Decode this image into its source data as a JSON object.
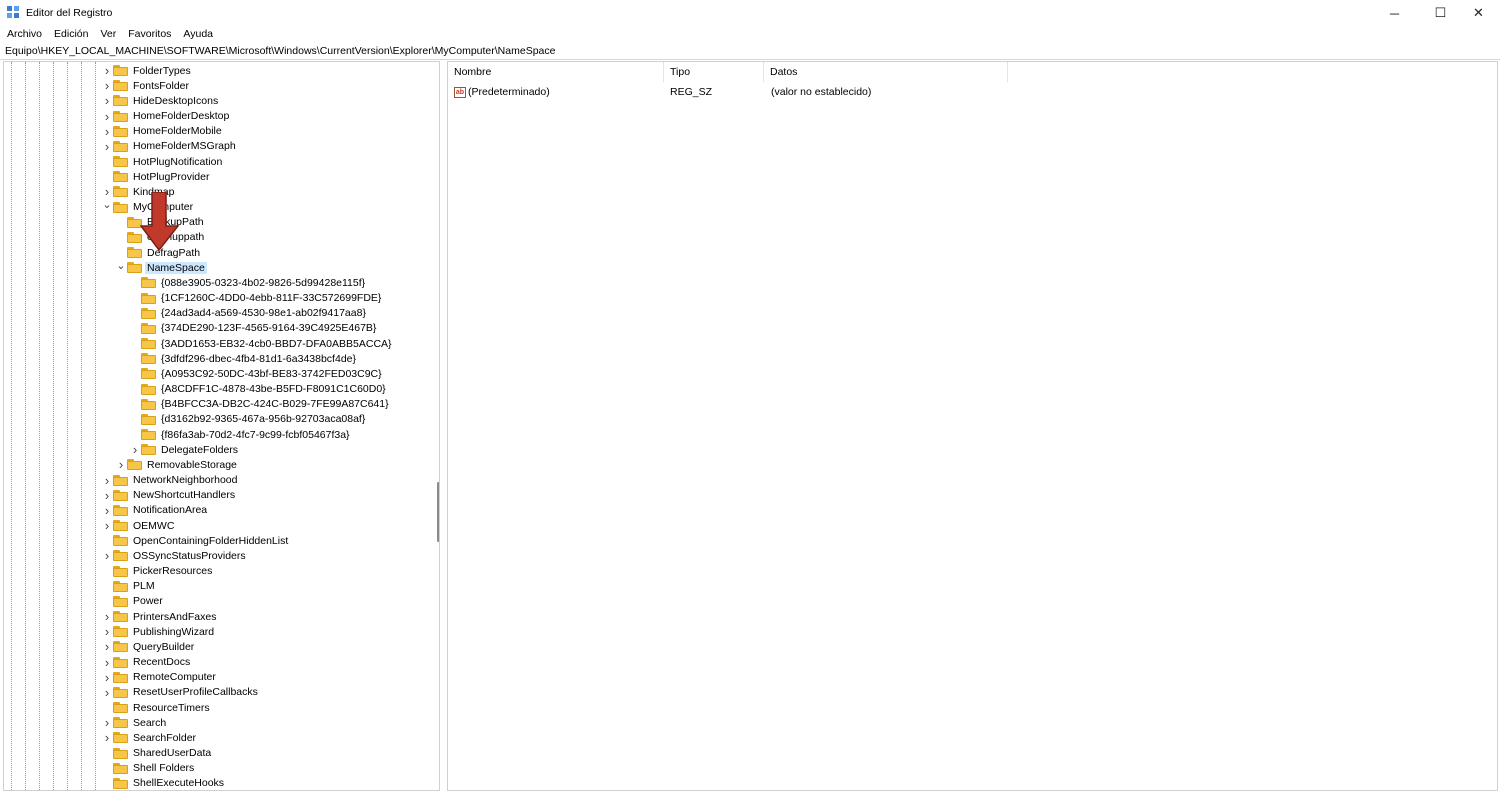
{
  "window": {
    "title": "Editor del Registro",
    "minimize": "─",
    "maximize": "☐",
    "close": "✕"
  },
  "menu": [
    "Archivo",
    "Edición",
    "Ver",
    "Favoritos",
    "Ayuda"
  ],
  "address": "Equipo\\HKEY_LOCAL_MACHINE\\SOFTWARE\\Microsoft\\Windows\\CurrentVersion\\Explorer\\MyComputer\\NameSpace",
  "tree": [
    {
      "label": "FolderTypes",
      "expander": "collapsed",
      "level": 0
    },
    {
      "label": "FontsFolder",
      "expander": "collapsed",
      "level": 0
    },
    {
      "label": "HideDesktopIcons",
      "expander": "collapsed",
      "level": 0
    },
    {
      "label": "HomeFolderDesktop",
      "expander": "collapsed",
      "level": 0
    },
    {
      "label": "HomeFolderMobile",
      "expander": "collapsed",
      "level": 0
    },
    {
      "label": "HomeFolderMSGraph",
      "expander": "collapsed",
      "level": 0
    },
    {
      "label": "HotPlugNotification",
      "expander": "none",
      "level": 0
    },
    {
      "label": "HotPlugProvider",
      "expander": "none",
      "level": 0
    },
    {
      "label": "Kindmap",
      "expander": "collapsed",
      "level": 0
    },
    {
      "label": "MyComputer",
      "expander": "expanded",
      "level": 0
    },
    {
      "label": "BackupPath",
      "expander": "none",
      "level": 1
    },
    {
      "label": "cleanuppath",
      "expander": "none",
      "level": 1
    },
    {
      "label": "DefragPath",
      "expander": "none",
      "level": 1
    },
    {
      "label": "NameSpace",
      "expander": "expanded",
      "level": 1,
      "selected": true
    },
    {
      "label": "{088e3905-0323-4b02-9826-5d99428e115f}",
      "expander": "none",
      "level": 2
    },
    {
      "label": "{1CF1260C-4DD0-4ebb-811F-33C572699FDE}",
      "expander": "none",
      "level": 2
    },
    {
      "label": "{24ad3ad4-a569-4530-98e1-ab02f9417aa8}",
      "expander": "none",
      "level": 2
    },
    {
      "label": "{374DE290-123F-4565-9164-39C4925E467B}",
      "expander": "none",
      "level": 2
    },
    {
      "label": "{3ADD1653-EB32-4cb0-BBD7-DFA0ABB5ACCA}",
      "expander": "none",
      "level": 2
    },
    {
      "label": "{3dfdf296-dbec-4fb4-81d1-6a3438bcf4de}",
      "expander": "none",
      "level": 2
    },
    {
      "label": "{A0953C92-50DC-43bf-BE83-3742FED03C9C}",
      "expander": "none",
      "level": 2
    },
    {
      "label": "{A8CDFF1C-4878-43be-B5FD-F8091C1C60D0}",
      "expander": "none",
      "level": 2
    },
    {
      "label": "{B4BFCC3A-DB2C-424C-B029-7FE99A87C641}",
      "expander": "none",
      "level": 2
    },
    {
      "label": "{d3162b92-9365-467a-956b-92703aca08af}",
      "expander": "none",
      "level": 2
    },
    {
      "label": "{f86fa3ab-70d2-4fc7-9c99-fcbf05467f3a}",
      "expander": "none",
      "level": 2
    },
    {
      "label": "DelegateFolders",
      "expander": "collapsed",
      "level": 2
    },
    {
      "label": "RemovableStorage",
      "expander": "collapsed",
      "level": 1
    },
    {
      "label": "NetworkNeighborhood",
      "expander": "collapsed",
      "level": 0
    },
    {
      "label": "NewShortcutHandlers",
      "expander": "collapsed",
      "level": 0
    },
    {
      "label": "NotificationArea",
      "expander": "collapsed",
      "level": 0
    },
    {
      "label": "OEMWC",
      "expander": "collapsed",
      "level": 0
    },
    {
      "label": "OpenContainingFolderHiddenList",
      "expander": "none",
      "level": 0
    },
    {
      "label": "OSSyncStatusProviders",
      "expander": "collapsed",
      "level": 0
    },
    {
      "label": "PickerResources",
      "expander": "none",
      "level": 0
    },
    {
      "label": "PLM",
      "expander": "none",
      "level": 0
    },
    {
      "label": "Power",
      "expander": "none",
      "level": 0
    },
    {
      "label": "PrintersAndFaxes",
      "expander": "collapsed",
      "level": 0
    },
    {
      "label": "PublishingWizard",
      "expander": "collapsed",
      "level": 0
    },
    {
      "label": "QueryBuilder",
      "expander": "collapsed",
      "level": 0
    },
    {
      "label": "RecentDocs",
      "expander": "collapsed",
      "level": 0
    },
    {
      "label": "RemoteComputer",
      "expander": "collapsed",
      "level": 0
    },
    {
      "label": "ResetUserProfileCallbacks",
      "expander": "collapsed",
      "level": 0
    },
    {
      "label": "ResourceTimers",
      "expander": "none",
      "level": 0
    },
    {
      "label": "Search",
      "expander": "collapsed",
      "level": 0
    },
    {
      "label": "SearchFolder",
      "expander": "collapsed",
      "level": 0
    },
    {
      "label": "SharedUserData",
      "expander": "none",
      "level": 0
    },
    {
      "label": "Shell Folders",
      "expander": "none",
      "level": 0
    },
    {
      "label": "ShellExecuteHooks",
      "expander": "none",
      "level": 0
    }
  ],
  "columns": {
    "name": "Nombre",
    "type": "Tipo",
    "data": "Datos"
  },
  "values": [
    {
      "icon": "ab",
      "name": "(Predeterminado)",
      "type": "REG_SZ",
      "data": "(valor no establecido)"
    }
  ],
  "colors": {
    "selection": "#cce8ff",
    "folder": "#f7c548",
    "arrow": "#c0392b"
  }
}
